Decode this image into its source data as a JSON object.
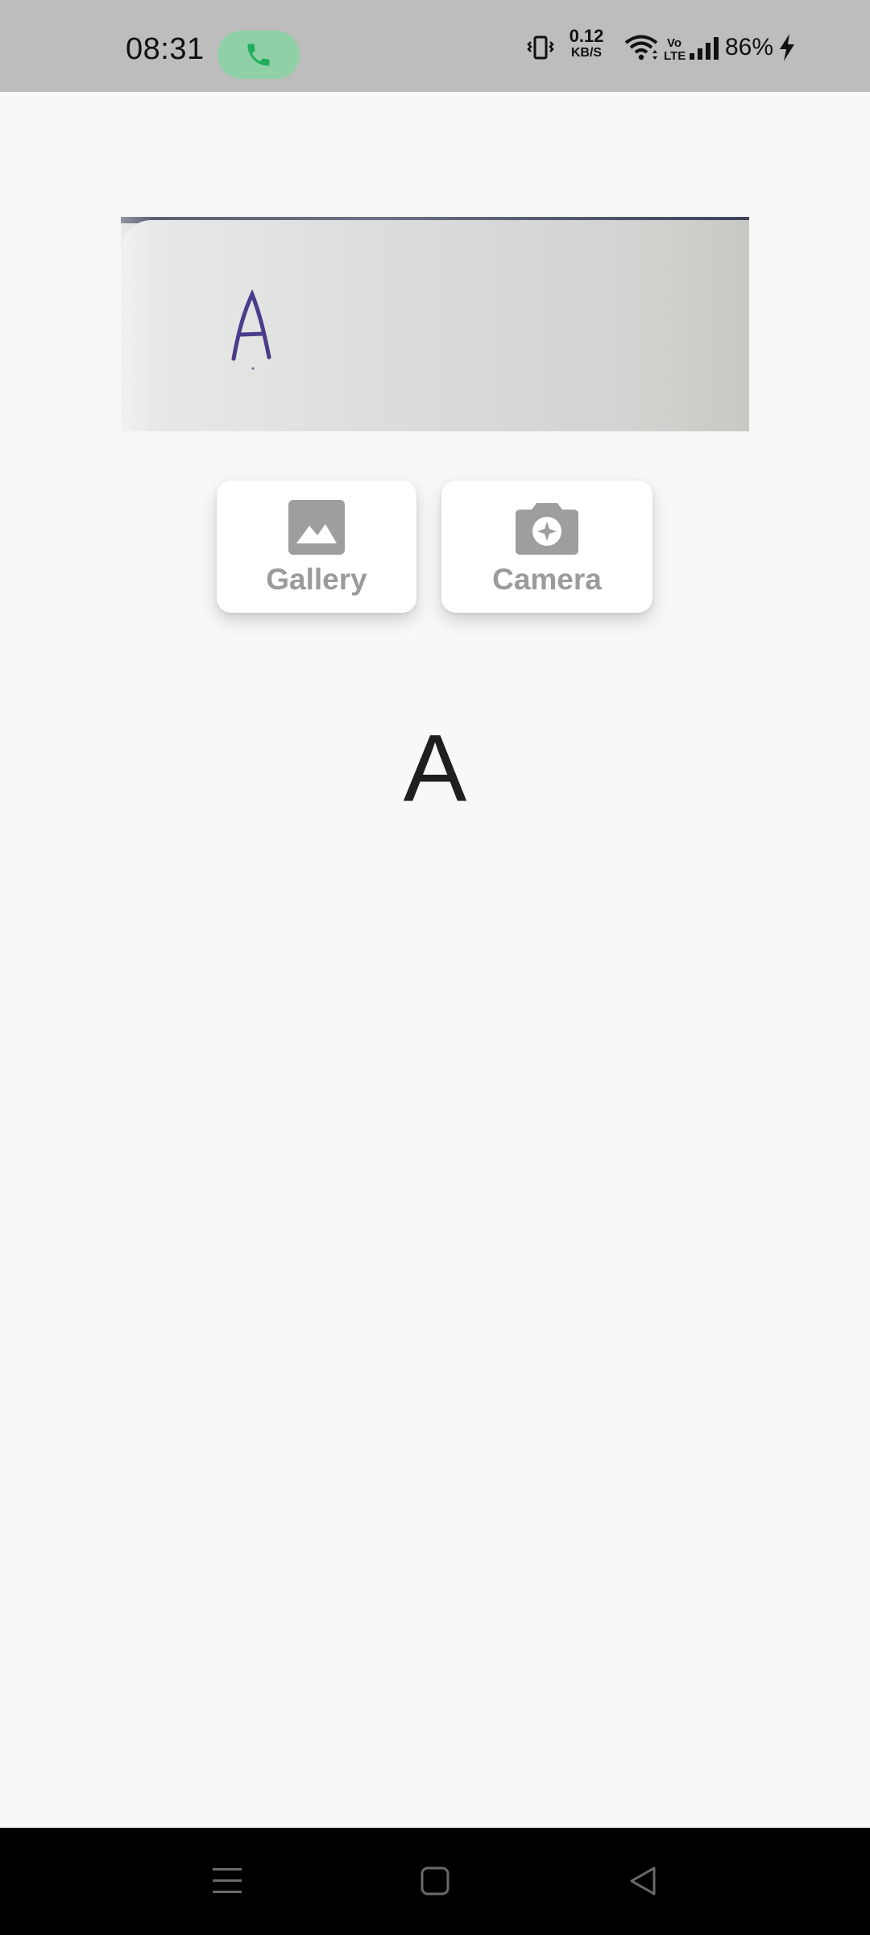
{
  "status_bar": {
    "time": "08:31",
    "net_speed_value": "0.12",
    "net_speed_unit": "KB/S",
    "volte_top": "Vo",
    "volte_bottom": "LTE",
    "battery_percent": "86%",
    "icons": [
      "phone-call-icon",
      "vibrate-icon",
      "wifi-icon",
      "signal-icon",
      "charging-icon"
    ],
    "call_pill_color": "#8fd0a6",
    "call_icon_color": "#1fae5b"
  },
  "preview": {
    "handwritten_letter": "A"
  },
  "buttons": {
    "gallery_label": "Gallery",
    "camera_label": "Camera",
    "gallery_icon": "image-icon",
    "camera_icon": "camera-icon",
    "icon_color": "#9e9e9e"
  },
  "result": {
    "text": "A"
  },
  "nav_bar": {
    "icons": [
      "menu-icon",
      "home-icon",
      "back-icon"
    ]
  }
}
